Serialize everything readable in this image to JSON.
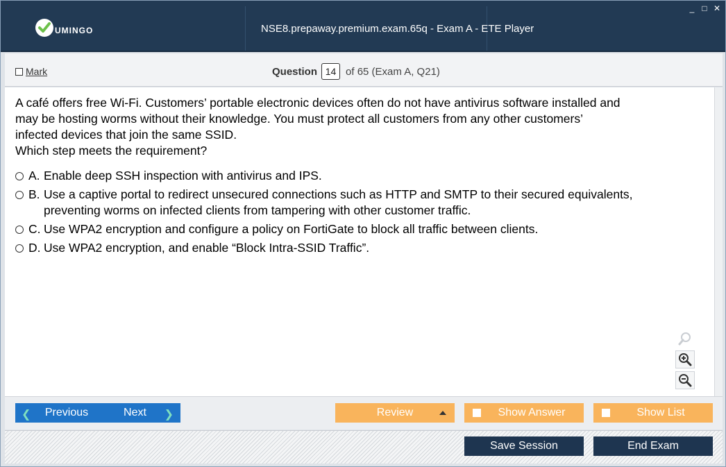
{
  "window": {
    "title": "NSE8.prepaway.premium.exam.65q - Exam A - ETE Player",
    "logo_text": "UMINGO",
    "controls": [
      "_",
      "□",
      "✕"
    ]
  },
  "question_bar": {
    "mark_label": "Mark",
    "question_label": "Question",
    "question_number": "14",
    "question_of": "of 65 (Exam A, Q21)"
  },
  "question": {
    "lines": [
      "A café offers free Wi-Fi. Customers’ portable electronic devices often do not have antivirus software installed and",
      "may be hosting worms without their knowledge. You must protect all customers from any other customers’",
      "infected devices that join the same SSID.",
      "Which step meets the requirement?"
    ]
  },
  "answers": [
    {
      "letter": "A.",
      "text": "Enable deep SSH inspection with antivirus and IPS."
    },
    {
      "letter": "B.",
      "text": "Use a captive portal to redirect unsecured connections such as HTTP and SMTP to their secured equivalents, preventing worms on infected clients from tampering with other customer traffic."
    },
    {
      "letter": "C.",
      "text": "Use WPA2 encryption and configure a policy on FortiGate to block all traffic between clients."
    },
    {
      "letter": "D.",
      "text": "Use WPA2 encryption, and enable “Block Intra-SSID Traffic”."
    }
  ],
  "zoom_tools": [
    "zoom-reset-icon",
    "zoom-in-icon",
    "zoom-out-icon"
  ],
  "navigation": {
    "previous_label": "Previous",
    "next_label": "Next",
    "review_label": "Review",
    "show_answer_label": "Show Answer",
    "show_list_label": "Show List"
  },
  "footer": {
    "save_session_label": "Save Session",
    "end_exam_label": "End Exam"
  },
  "colors": {
    "titlebar": "#223a54",
    "nav_blue": "#1f74c8",
    "orange": "#f9b45c",
    "dark_button": "#1e3550",
    "logo_green": "#6cc04a"
  }
}
